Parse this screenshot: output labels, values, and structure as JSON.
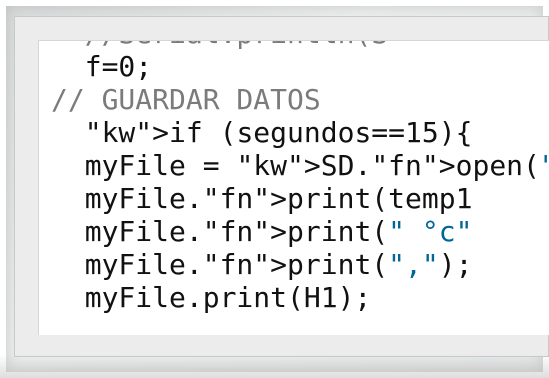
{
  "code_lines": [
    "  //Serial.println(S",
    "  f=0;",
    "// GUARDAR DATOS",
    "  if (segundos==15){",
    "  myFile = SD.open(\"",
    "  myFile.print(temp1",
    "  myFile.print(\" °c\"",
    "  myFile.print(\",\");",
    "  myFile.print(H1);"
  ],
  "colors": {
    "comment": "#7b7b7b",
    "keyword": "#b85d00",
    "function": "#d35400",
    "string": "#006699",
    "text": "#111111"
  }
}
